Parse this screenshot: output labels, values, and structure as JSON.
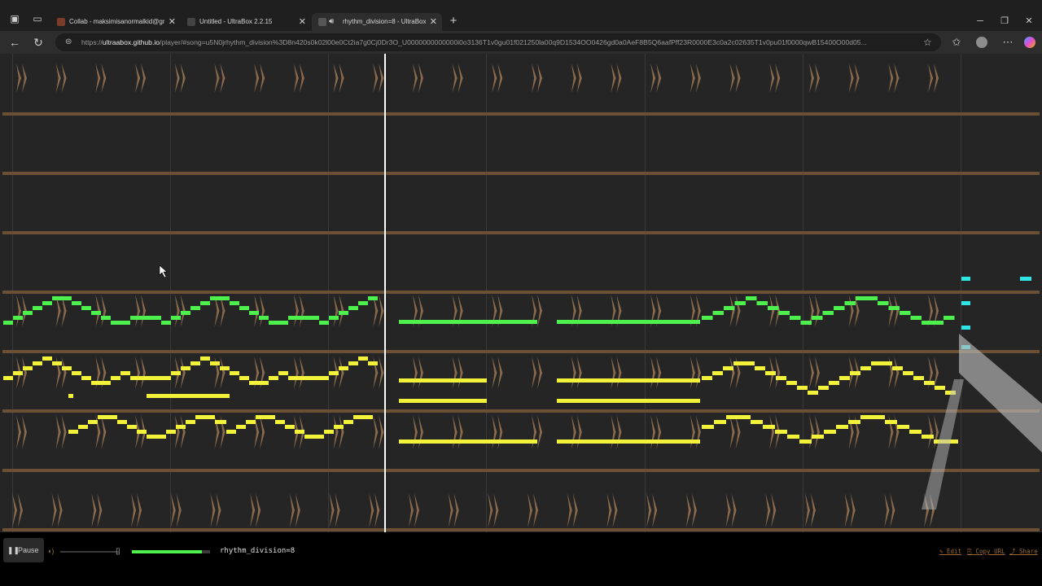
{
  "browser": {
    "tabs": [
      {
        "title": "Collab - maksimisanormalkid@gm",
        "active": false
      },
      {
        "title": "Untitled - UltraBox 2.2.15",
        "active": false
      },
      {
        "title": "rhythm_division=8 - UltraBox",
        "active": true
      }
    ],
    "url_scheme": "https://",
    "url_host": "ultraabox.github.io",
    "url_path": "/player/#song=u5N0jrhythm_division%3D8n420s0k02l00e0Ct2ia7g0Cj0Dr3O_U0000000000000i0o3136T1v0gu01f021250la00q9D1534OO0426gd0a0AeF8B5Q6aafPff23R0000E3c0a2c02635T1v0pu01f0000qwB15400O00d05..."
  },
  "player": {
    "pause_label": "Pause",
    "song_name": "rhythm_division=8",
    "edit_label": "Edit",
    "copy_url_label": "Copy URL",
    "share_label": "Share",
    "playback_progress_fraction": 0.9
  },
  "colors": {
    "background": "#252525",
    "channel_divider": "#6b5035",
    "drum_note": "#9c7753",
    "green_channel": "#4ef04e",
    "yellow_channel": "#f2f23a",
    "cyan_channel": "#2fe6e6",
    "playhead": "#ffffff"
  },
  "icons": {
    "pause": "pause-icon",
    "volume": "volume-icon",
    "mouse_cursor": "mouse-cursor-icon"
  }
}
